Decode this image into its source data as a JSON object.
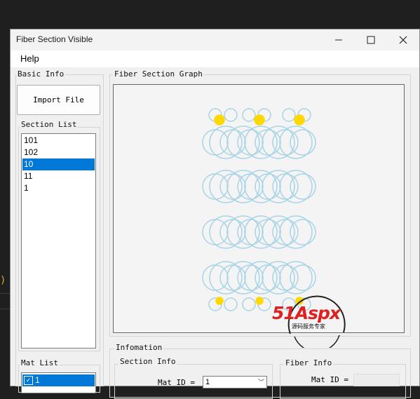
{
  "window": {
    "title": "Fiber Section Visible"
  },
  "menu": {
    "items": [
      "Help"
    ]
  },
  "basic_info": {
    "label": "Basic Info",
    "import_button": "Import File"
  },
  "section_list": {
    "label": "Section List",
    "items": [
      "101",
      "102",
      "10",
      "11",
      "1"
    ],
    "selected_index": 2
  },
  "mat_list": {
    "label": "Mat List",
    "items": [
      {
        "text": "1",
        "checked": true
      }
    ]
  },
  "graph": {
    "label": "Fiber Section Graph"
  },
  "info": {
    "label": "Infomation",
    "section_info": {
      "label": "Section Info",
      "mat_id_label": "Mat ID =",
      "mat_id_value": "1"
    },
    "fiber_info": {
      "label": "Fiber Info",
      "mat_id_label": "Mat ID =",
      "mat_id_value": ""
    }
  },
  "watermark": {
    "brand": "51Aspx",
    "tagline": "源码服务专家"
  },
  "colors": {
    "fiber_circle": "#a8d4e6",
    "rebar": "#ffd800",
    "selection": "#0078d7",
    "brand_red": "#e02020",
    "brand_green": "#2aa845"
  }
}
